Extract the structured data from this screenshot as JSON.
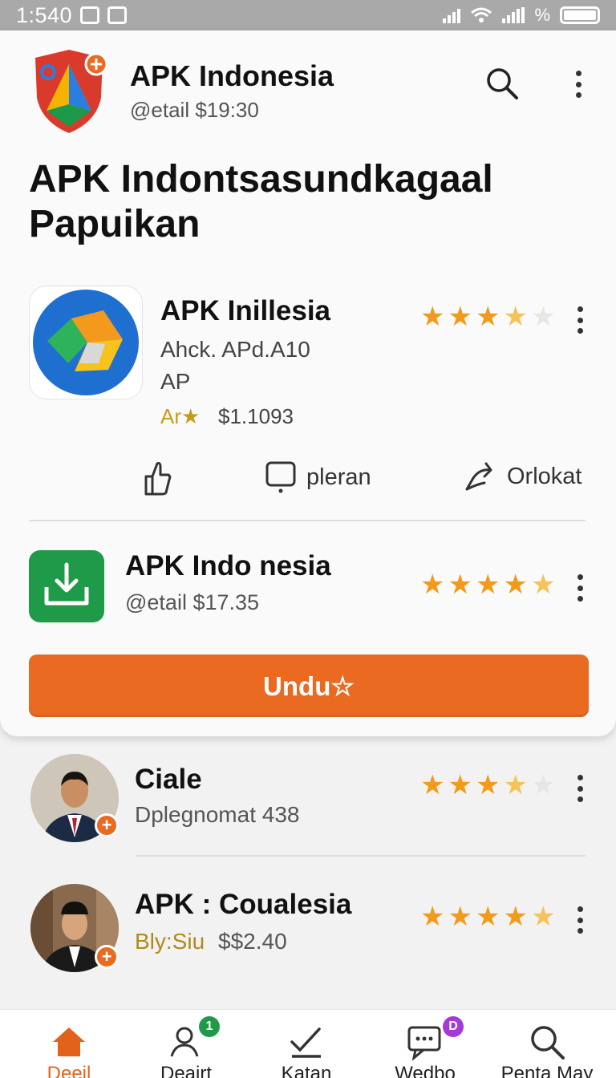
{
  "status_bar": {
    "time": "1:540",
    "battery_percent_symbol": "%"
  },
  "header": {
    "title": "APK Indonesia",
    "subtitle": "@etail  $19:30"
  },
  "hero_title": "APK Indontsasundkagaal Papuikan",
  "featured_app": {
    "name": "APK Inillesia",
    "line1": "Ahck. APd.A10",
    "line2": "AP",
    "badge": "Ar★",
    "price": "$1.1093",
    "rating": 3.5
  },
  "actions": {
    "comment_label": "pleran",
    "share_label": "Orlokat"
  },
  "second_app": {
    "name": "APK Indo nesia",
    "subtitle": "@etail  $17.35",
    "rating": 4.5
  },
  "download_button": {
    "label": "Undu☆"
  },
  "list_items": [
    {
      "name": "Ciale",
      "subtitle": "Dplegnomat 438",
      "rating": 3.5
    },
    {
      "name": "APK : Coualesia",
      "tag": "Bly:Siu",
      "price": "$$2.40",
      "rating": 4.5
    }
  ],
  "bottom_nav": [
    {
      "label": "Deeil",
      "icon": "home-icon",
      "active": true
    },
    {
      "label": "Deairt",
      "icon": "person-icon",
      "badge": "1"
    },
    {
      "label": "Katan",
      "icon": "check-edit-icon"
    },
    {
      "label": "Wedbo",
      "icon": "chat-icon",
      "badge": "D"
    },
    {
      "label": "Penta May",
      "icon": "search-icon"
    }
  ],
  "colors": {
    "accent": "#ea6a21",
    "star": "#f29a1b",
    "green": "#1f9a49",
    "status_bar": "#a9a9a9"
  }
}
